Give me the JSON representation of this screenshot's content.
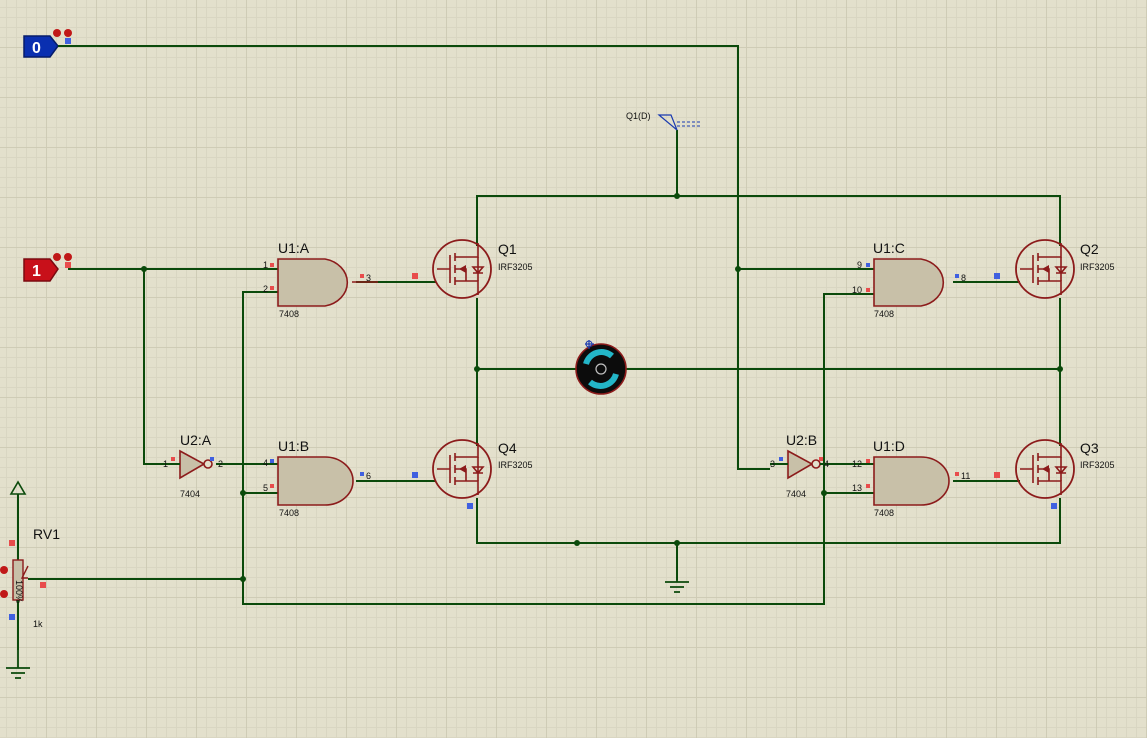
{
  "terminals": [
    {
      "name": "input-terminal-0",
      "value": "0",
      "color": "#0a2fb0",
      "state": "low"
    },
    {
      "name": "input-terminal-1",
      "value": "1",
      "color": "#c8101a",
      "state": "high"
    }
  ],
  "probe": {
    "label": "Q1(D)"
  },
  "gates": {
    "u1a": {
      "ref": "U1:A",
      "part": "7408",
      "pins": [
        "1",
        "2",
        "3"
      ]
    },
    "u1b": {
      "ref": "U1:B",
      "part": "7408",
      "pins": [
        "4",
        "5",
        "6"
      ]
    },
    "u1c": {
      "ref": "U1:C",
      "part": "7408",
      "pins": [
        "9",
        "10",
        "8"
      ]
    },
    "u1d": {
      "ref": "U1:D",
      "part": "7408",
      "pins": [
        "12",
        "13",
        "11"
      ]
    },
    "u2a": {
      "ref": "U2:A",
      "part": "7404",
      "pins": [
        "1",
        "2"
      ]
    },
    "u2b": {
      "ref": "U2:B",
      "part": "7404",
      "pins": [
        "3",
        "4"
      ]
    }
  },
  "mosfets": {
    "q1": {
      "ref": "Q1",
      "part": "IRF3205"
    },
    "q2": {
      "ref": "Q2",
      "part": "IRF3205"
    },
    "q3": {
      "ref": "Q3",
      "part": "IRF3205"
    },
    "q4": {
      "ref": "Q4",
      "part": "IRF3205"
    }
  },
  "pot": {
    "ref": "RV1",
    "value": "1k",
    "position_label": "100%"
  },
  "colors": {
    "wire": "#0b4a0b",
    "component_outline": "#8c1b1b",
    "component_fill": "#c8c0a8",
    "grid": "#e3e0cc",
    "logic_high_pin": "#e84c4c",
    "logic_low_pin": "#4060e0"
  }
}
